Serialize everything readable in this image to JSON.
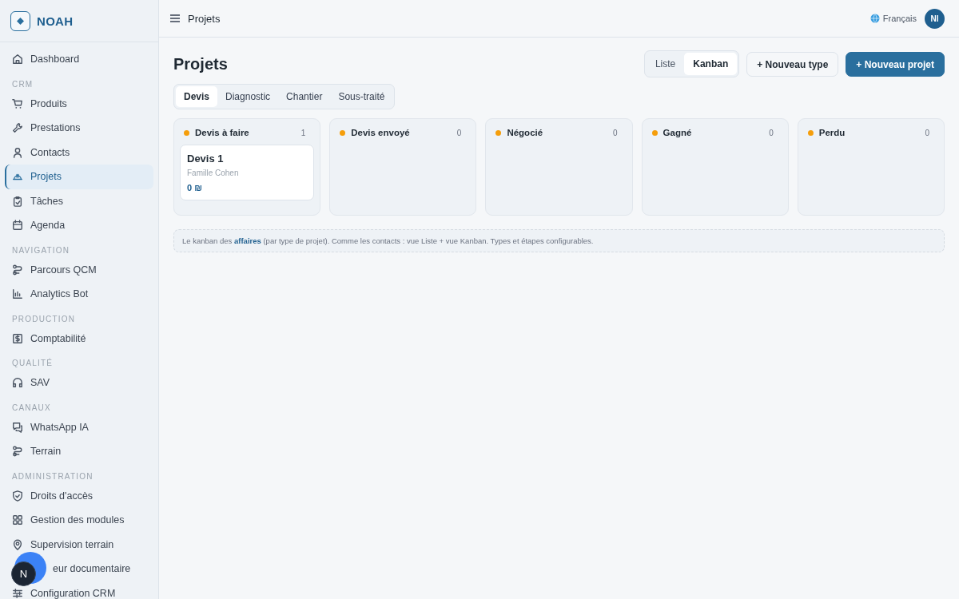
{
  "sidebar": {
    "logo": "NOAH",
    "items": [
      {
        "kind": "item",
        "label": "Dashboard",
        "selected": false
      },
      {
        "kind": "section",
        "label": "CRM"
      },
      {
        "kind": "item",
        "label": "Produits",
        "selected": false
      },
      {
        "kind": "item",
        "label": "Prestations",
        "selected": false
      },
      {
        "kind": "item",
        "label": "Contacts",
        "selected": false
      },
      {
        "kind": "item",
        "label": "Projets",
        "selected": true
      },
      {
        "kind": "item",
        "label": "Tâches",
        "selected": false
      },
      {
        "kind": "item",
        "label": "Agenda",
        "selected": false
      },
      {
        "kind": "section",
        "label": "NAVIGATION"
      },
      {
        "kind": "item",
        "label": "Parcours QCM",
        "selected": false
      },
      {
        "kind": "item",
        "label": "Analytics Bot",
        "selected": false
      },
      {
        "kind": "section",
        "label": "PRODUCTION"
      },
      {
        "kind": "item",
        "label": "Comptabilité",
        "selected": false
      },
      {
        "kind": "section",
        "label": "QUALITÉ"
      },
      {
        "kind": "item",
        "label": "SAV",
        "selected": false
      },
      {
        "kind": "section",
        "label": "CANAUX"
      },
      {
        "kind": "item",
        "label": "WhatsApp IA",
        "selected": false
      },
      {
        "kind": "item",
        "label": "Terrain",
        "selected": false
      },
      {
        "kind": "section",
        "label": "ADMINISTRATION"
      },
      {
        "kind": "item",
        "label": "Droits d'accès",
        "selected": false
      },
      {
        "kind": "item",
        "label": "Gestion des modules",
        "selected": false
      },
      {
        "kind": "item",
        "label": "Supervision terrain",
        "selected": false
      },
      {
        "kind": "covered",
        "label": "eur documentaire",
        "selected": false
      },
      {
        "kind": "item",
        "label": "Configuration CRM",
        "selected": false
      }
    ],
    "assistant": {
      "badge": "N"
    }
  },
  "header": {
    "title": "Projets",
    "language": "Français",
    "avatar": "NI"
  },
  "page": {
    "title": "Projets",
    "views": [
      {
        "label": "Liste",
        "selected": false
      },
      {
        "label": "Kanban",
        "selected": true
      }
    ],
    "buttons": [
      {
        "kind": "secondary",
        "label": "+ Nouveau type"
      },
      {
        "kind": "primary",
        "label": "+ Nouveau projet"
      }
    ],
    "tabs": [
      {
        "label": "Devis",
        "selected": true
      },
      {
        "label": "Diagnostic",
        "selected": false
      },
      {
        "label": "Chantier",
        "selected": false
      },
      {
        "label": "Sous-traité",
        "selected": false
      }
    ],
    "columns": [
      {
        "title": "Devis à faire",
        "count": "1",
        "color": "#f59e0b",
        "cards": [
          {
            "title": "Devis 1",
            "client": "Famille Cohen",
            "amount": "0 ₪"
          }
        ]
      },
      {
        "title": "Devis envoyé",
        "count": "0",
        "color": "#f59e0b"
      },
      {
        "title": "Négocié",
        "count": "0",
        "color": "#f59e0b"
      },
      {
        "title": "Gagné",
        "count": "0",
        "color": "#f59e0b"
      },
      {
        "title": "Perdu",
        "count": "0",
        "color": "#f59e0b"
      }
    ],
    "note": "Le kanban des **affaires** (par type de projet). Comme les contacts : vue Liste + vue Kanban. Types et étapes configurables."
  }
}
